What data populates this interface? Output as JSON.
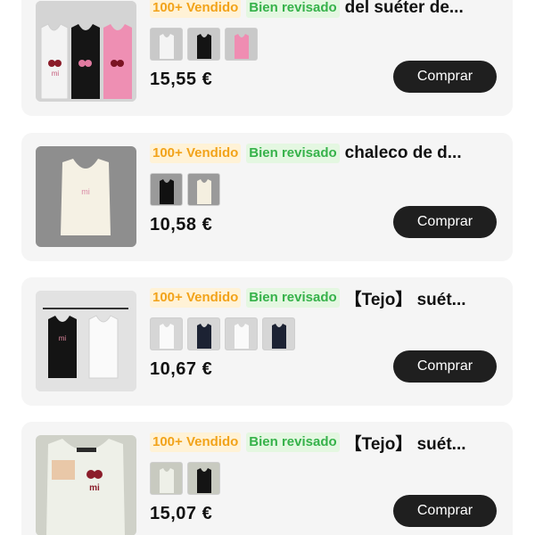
{
  "products": [
    {
      "badge_sold": "100+ Vendido",
      "badge_check": "Bien revisado",
      "title": "del suéter de...",
      "price": "15,55 €",
      "buy_label": "Comprar",
      "variants": [
        "white-top",
        "black-top",
        "pink-top"
      ]
    },
    {
      "badge_sold": "100+ Vendido",
      "badge_check": "Bien revisado",
      "title": "chaleco de d...",
      "price": "10,58 €",
      "buy_label": "Comprar",
      "variants": [
        "black-top",
        "cream-top"
      ]
    },
    {
      "badge_sold": "100+ Vendido",
      "badge_check": "Bien revisado",
      "title": "【Tejo】 suét...",
      "price": "10,67 €",
      "buy_label": "Comprar",
      "variants": [
        "white-top",
        "navy-top",
        "white-top",
        "navy-top"
      ]
    },
    {
      "badge_sold": "100+ Vendido",
      "badge_check": "Bien revisado",
      "title": "【Tejo】 suét...",
      "price": "15,07 €",
      "buy_label": "Comprar",
      "variants": [
        "white-top",
        "black-top"
      ]
    }
  ],
  "thumb_labels": [
    "mi",
    "mi",
    "mi",
    "mi"
  ]
}
